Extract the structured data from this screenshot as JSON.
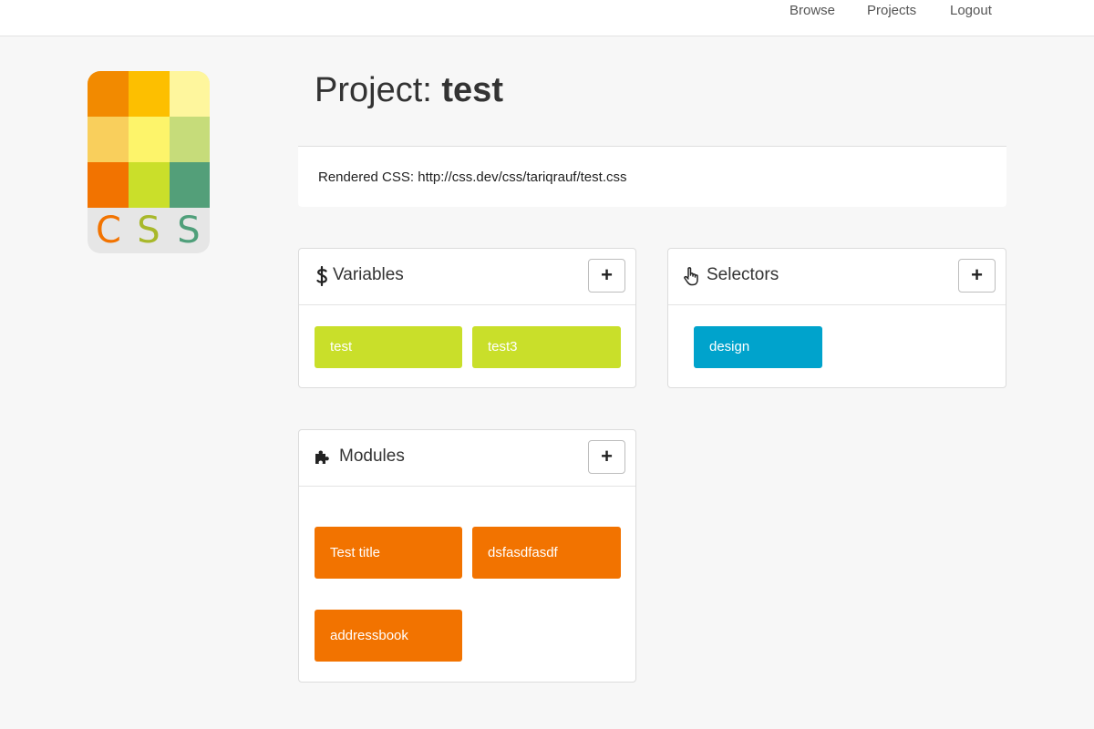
{
  "nav": {
    "browse": "Browse",
    "projects": "Projects",
    "logout": "Logout"
  },
  "logo": {
    "letters": [
      "C",
      "S",
      "S"
    ],
    "letter_colors": [
      "#f27300",
      "#a8b82a",
      "#4f9f7a"
    ],
    "grid_colors": [
      [
        "#f28a00",
        "#fdbf00",
        "#fef69d"
      ],
      [
        "#f9cf5c",
        "#fdf46a",
        "#c6dc7a"
      ],
      [
        "#f27300",
        "#cadf2a",
        "#539f79"
      ]
    ]
  },
  "page": {
    "title_prefix": "Project:",
    "title_name": "test"
  },
  "rendered_css": {
    "label": "Rendered CSS:",
    "url": "http://css.dev/css/tariqrauf/test.css"
  },
  "variables": {
    "title": "Variables",
    "icon": "dollar-icon",
    "add_label": "+",
    "items": [
      "test",
      "test3"
    ],
    "color": "#c9df2a"
  },
  "selectors": {
    "title": "Selectors",
    "icon": "pointer-hand-icon",
    "add_label": "+",
    "items": [
      "design"
    ],
    "color": "#00a3cc"
  },
  "modules": {
    "title": "Modules",
    "icon": "puzzle-icon",
    "add_label": "+",
    "items": [
      "Test title",
      "dsfasdfasdf",
      "addressbook"
    ],
    "color": "#f27300"
  }
}
